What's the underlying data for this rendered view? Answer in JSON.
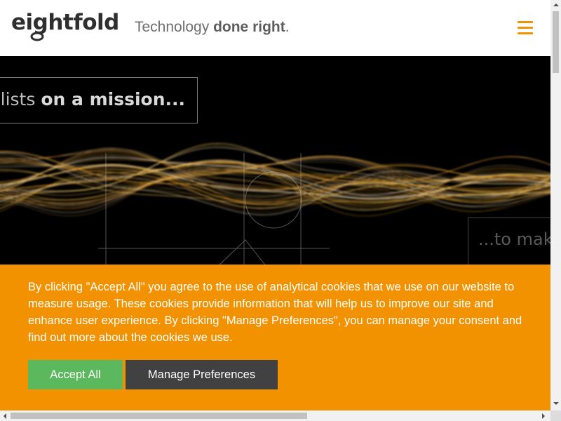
{
  "header": {
    "logo_text": "eightfold",
    "tagline_regular": "Technology ",
    "tagline_bold": "done right",
    "tagline_end": ".",
    "menu_icon": "hamburger-menu-icon"
  },
  "hero": {
    "mission_regular": "alists ",
    "mission_bold": "on a mission...",
    "make_text": "...to mak"
  },
  "cookie_banner": {
    "message": "By clicking \"Accept All\" you agree to the use of analytical cookies that we use on our website to measure usage. These cookies provide information that will help us to improve our site and enhance user experience. By clicking \"Manage Preferences\", you can manage your consent and find out more about the cookies we use.",
    "accept_label": "Accept All",
    "manage_label": "Manage Preferences"
  },
  "colors": {
    "accent": "#f39200",
    "accept_button": "#5cb85c",
    "manage_button": "#414141",
    "hero_background": "#000000"
  }
}
